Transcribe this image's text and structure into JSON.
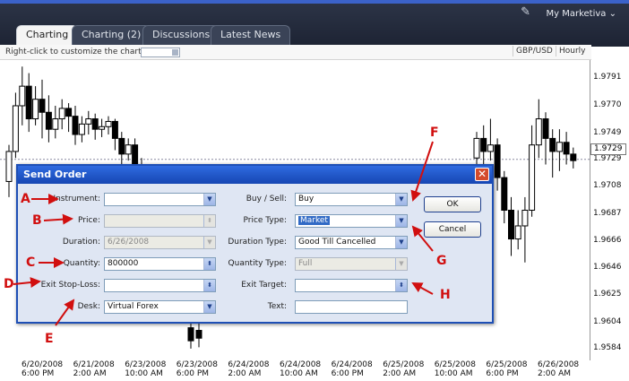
{
  "tabs": [
    {
      "label": "Charting",
      "active": true
    },
    {
      "label": "Charting (2)",
      "active": false
    },
    {
      "label": "Discussions",
      "active": false
    },
    {
      "label": "Latest News",
      "active": false
    }
  ],
  "account_menu": "My Marketiva",
  "chart_toolbar": {
    "hint": "Right-click to customize the chart",
    "pair": "GBP/USD",
    "period": "Hourly"
  },
  "chart_data": {
    "type": "candlestick",
    "y_ticks": [
      "1.9791",
      "1.9770",
      "1.9749",
      "1.9729",
      "1.9708",
      "1.9687",
      "1.9666",
      "1.9646",
      "1.9625",
      "1.9604",
      "1.9584"
    ],
    "ylim": [
      1.9575,
      1.9805
    ],
    "current_price": "1.9729",
    "x_ticks": [
      {
        "date": "6/20/2008",
        "time": "6:00 PM"
      },
      {
        "date": "6/21/2008",
        "time": "2:00 AM"
      },
      {
        "date": "6/23/2008",
        "time": "10:00 AM"
      },
      {
        "date": "6/23/2008",
        "time": "6:00 PM"
      },
      {
        "date": "6/24/2008",
        "time": "2:00 AM"
      },
      {
        "date": "6/24/2008",
        "time": "10:00 AM"
      },
      {
        "date": "6/24/2008",
        "time": "6:00 PM"
      },
      {
        "date": "6/25/2008",
        "time": "2:00 AM"
      },
      {
        "date": "6/25/2008",
        "time": "10:00 AM"
      },
      {
        "date": "6/25/2008",
        "time": "6:00 PM"
      },
      {
        "date": "6/26/2008",
        "time": "2:00 AM"
      }
    ],
    "candles_left": [
      [
        1.9712,
        1.9735,
        1.97,
        1.974
      ],
      [
        1.9735,
        1.977,
        1.973,
        1.978
      ],
      [
        1.977,
        1.9785,
        1.9755,
        1.98
      ],
      [
        1.9785,
        1.976,
        1.975,
        1.9795
      ],
      [
        1.976,
        1.9775,
        1.9755,
        1.9785
      ],
      [
        1.9775,
        1.9765,
        1.9745,
        1.979
      ],
      [
        1.9765,
        1.9752,
        1.9742,
        1.9778
      ],
      [
        1.9752,
        1.976,
        1.9745,
        1.977
      ],
      [
        1.976,
        1.9768,
        1.9752,
        1.9775
      ],
      [
        1.9768,
        1.9762,
        1.975,
        1.9772
      ],
      [
        1.9762,
        1.9748,
        1.974,
        1.977
      ],
      [
        1.9748,
        1.9756,
        1.9742,
        1.9762
      ],
      [
        1.9756,
        1.976,
        1.9748,
        1.9766
      ],
      [
        1.976,
        1.9752,
        1.9744,
        1.9764
      ],
      [
        1.9752,
        1.9754,
        1.9746,
        1.976
      ],
      [
        1.9754,
        1.9758,
        1.9748,
        1.9762
      ],
      [
        1.9758,
        1.9745,
        1.9736,
        1.976
      ],
      [
        1.9745,
        1.9733,
        1.9725,
        1.975
      ],
      [
        1.9733,
        1.974,
        1.9728,
        1.9745
      ],
      [
        1.974,
        1.9725,
        1.9715,
        1.9745
      ],
      [
        1.9725,
        1.9718,
        1.971,
        1.973
      ]
    ],
    "candles_right": [
      [
        1.973,
        1.9745,
        1.97,
        1.975
      ],
      [
        1.9745,
        1.9735,
        1.9725,
        1.9755
      ],
      [
        1.9735,
        1.974,
        1.9728,
        1.976
      ],
      [
        1.974,
        1.9715,
        1.9705,
        1.9745
      ],
      [
        1.9715,
        1.969,
        1.968,
        1.972
      ],
      [
        1.969,
        1.9668,
        1.9655,
        1.97
      ],
      [
        1.9668,
        1.9678,
        1.966,
        1.969
      ],
      [
        1.9678,
        1.969,
        1.965,
        1.97
      ],
      [
        1.969,
        1.974,
        1.9685,
        1.9755
      ],
      [
        1.974,
        1.976,
        1.973,
        1.9775
      ],
      [
        1.976,
        1.9745,
        1.9725,
        1.9765
      ],
      [
        1.9745,
        1.9735,
        1.9715,
        1.9752
      ],
      [
        1.9735,
        1.9742,
        1.972,
        1.9752
      ],
      [
        1.9742,
        1.9733,
        1.9725,
        1.975
      ],
      [
        1.9733,
        1.9728,
        1.9722,
        1.9738
      ]
    ],
    "candles_bottom": [
      [
        1.96,
        1.959,
        1.9584,
        1.9605
      ],
      [
        1.9598,
        1.9592,
        1.9585,
        1.9604
      ]
    ]
  },
  "dialog": {
    "title": "Send Order",
    "labels": {
      "instrument": "Instrument:",
      "price": "Price:",
      "duration": "Duration:",
      "quantity": "Quantity:",
      "exit_stop_loss": "Exit Stop-Loss:",
      "desk": "Desk:",
      "buy_sell": "Buy / Sell:",
      "price_type": "Price Type:",
      "duration_type": "Duration Type:",
      "quantity_type": "Quantity Type:",
      "exit_target": "Exit Target:",
      "text": "Text:"
    },
    "values": {
      "instrument": "",
      "price": "",
      "duration": "6/26/2008",
      "quantity": "800000",
      "exit_stop_loss": "",
      "desk": "Virtual Forex",
      "buy_sell": "Buy",
      "price_type": "Market",
      "duration_type": "Good Till Cancelled",
      "quantity_type": "Full",
      "exit_target": "",
      "text": ""
    },
    "buttons": {
      "ok": "OK",
      "cancel": "Cancel"
    }
  },
  "annotations": {
    "a": "A",
    "b": "B",
    "c": "C",
    "d": "D",
    "e": "E",
    "f": "F",
    "g": "G",
    "h": "H"
  },
  "colors": {
    "annotation": "#d10f0f",
    "dialog_border": "#1e4fb5",
    "dialog_bg": "#dfe6f3",
    "highlight": "#316ac5"
  }
}
